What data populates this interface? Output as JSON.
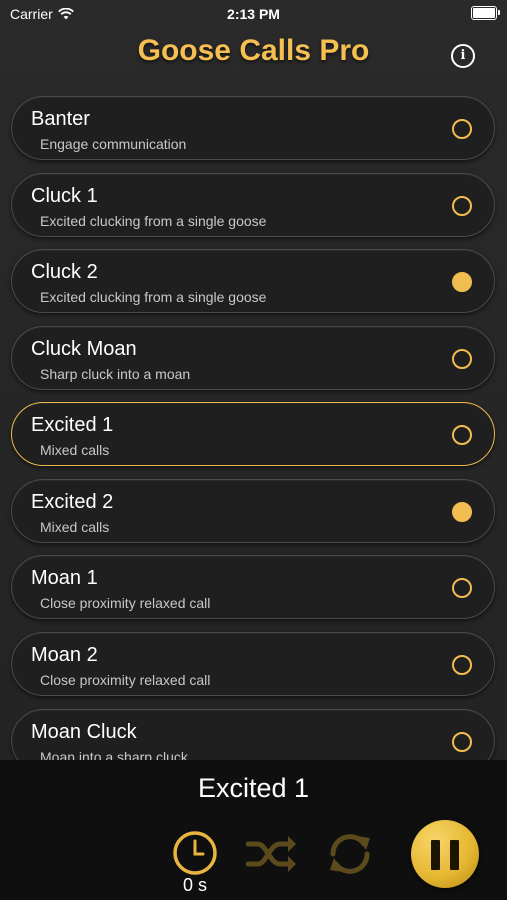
{
  "status_bar": {
    "carrier": "Carrier",
    "time": "2:13 PM"
  },
  "header": {
    "title": "Goose Calls Pro",
    "info_icon": "i"
  },
  "calls": [
    {
      "title": "Banter",
      "subtitle": "Engage communication",
      "marked": false,
      "selected": false
    },
    {
      "title": "Cluck 1",
      "subtitle": "Excited clucking from a single goose",
      "marked": false,
      "selected": false
    },
    {
      "title": "Cluck 2",
      "subtitle": "Excited clucking from a single goose",
      "marked": true,
      "selected": false
    },
    {
      "title": "Cluck Moan",
      "subtitle": "Sharp cluck into a moan",
      "marked": false,
      "selected": false
    },
    {
      "title": "Excited 1",
      "subtitle": "Mixed calls",
      "marked": false,
      "selected": true
    },
    {
      "title": "Excited 2",
      "subtitle": "Mixed calls",
      "marked": true,
      "selected": false
    },
    {
      "title": "Moan 1",
      "subtitle": "Close proximity relaxed call",
      "marked": false,
      "selected": false
    },
    {
      "title": "Moan 2",
      "subtitle": "Close proximity relaxed call",
      "marked": false,
      "selected": false
    },
    {
      "title": "Moan Cluck",
      "subtitle": "Moan into a sharp cluck",
      "marked": false,
      "selected": false
    }
  ],
  "player": {
    "now_playing": "Excited 1",
    "timer_label": "0 s"
  },
  "colors": {
    "accent": "#f2bd50",
    "title": "#f6bf52",
    "background": "#262626",
    "player_bg": "#0f0f0f"
  },
  "icons": {
    "timer": "clock-icon",
    "shuffle": "shuffle-icon",
    "repeat": "repeat-icon",
    "pause": "pause-icon",
    "info": "info-icon",
    "wifi": "wifi-icon",
    "battery": "battery-icon"
  }
}
